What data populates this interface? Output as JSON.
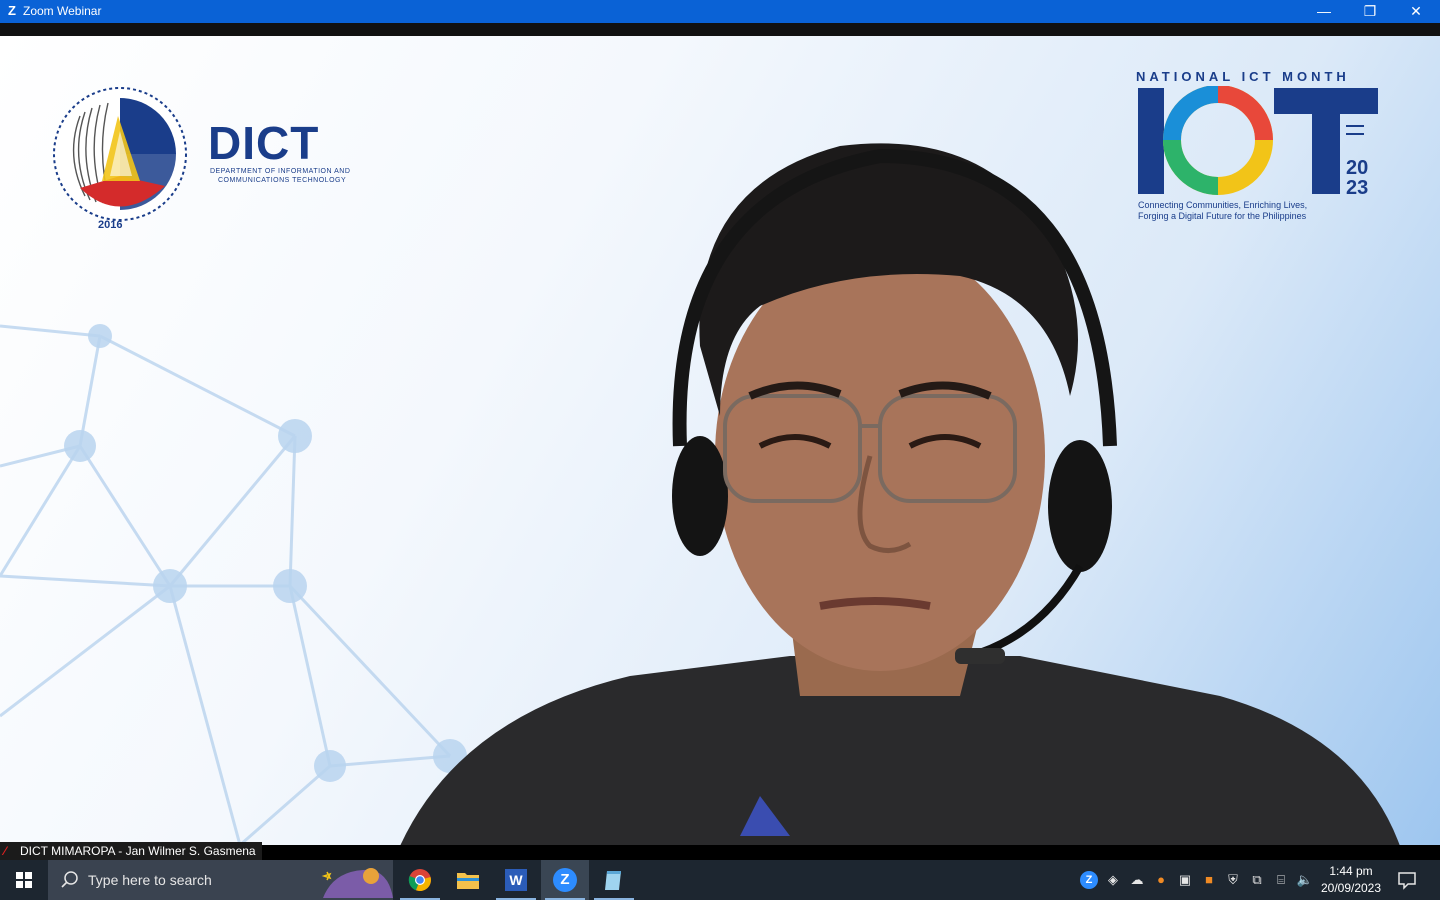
{
  "window": {
    "title": "Zoom Webinar",
    "logo": "Z",
    "controls": {
      "minimize": "—",
      "restore": "❐",
      "close": "✕"
    }
  },
  "video": {
    "dict_logo": {
      "wordmark": "DICT",
      "subtitle_line1": "DEPARTMENT OF INFORMATION AND",
      "subtitle_line2": "COMMUNICATIONS TECHNOLOGY",
      "year": "2016"
    },
    "ict_logo": {
      "heading": "NATIONAL ICT MONTH",
      "tagline_line1": "Connecting Communities, Enriching Lives,",
      "tagline_line2": "Forging a Digital Future for the Philippines"
    },
    "participant_label": "DICT MIMAROPA - Jan Wilmer S. Gasmena",
    "mic_state": "muted"
  },
  "taskbar": {
    "search_placeholder": "Type here to search",
    "apps": [
      {
        "name": "Google Chrome",
        "icon": "chrome-icon"
      },
      {
        "name": "File Explorer",
        "icon": "folder-icon"
      },
      {
        "name": "Microsoft Word",
        "icon": "word-icon",
        "glyph": "W"
      },
      {
        "name": "Zoom",
        "icon": "zoom-icon",
        "glyph": "Z"
      },
      {
        "name": "Notepad",
        "icon": "notepad-icon"
      }
    ],
    "clock": {
      "time": "1:44 pm",
      "date": "20/09/2023"
    }
  },
  "colors": {
    "titlebar": "#0a62d6",
    "taskbar": "#1d2630",
    "brand_blue": "#1a3d8a"
  }
}
